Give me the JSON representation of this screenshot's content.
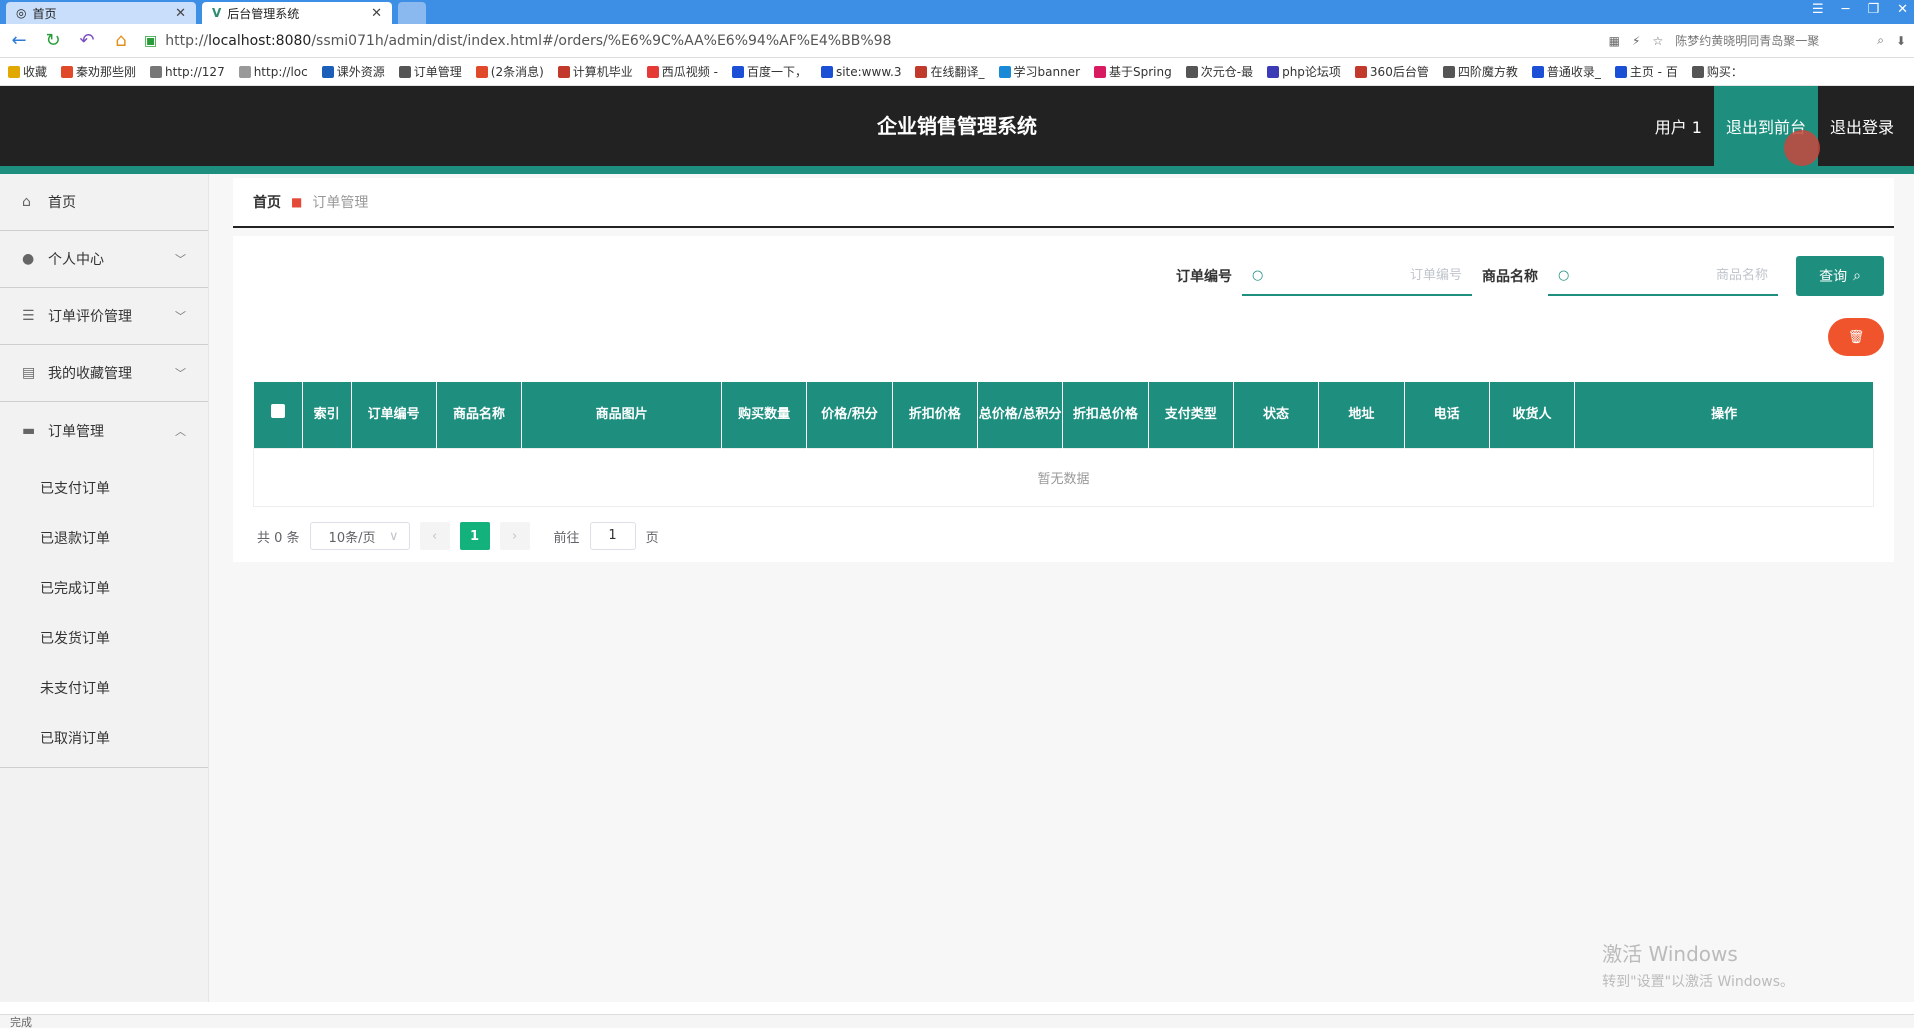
{
  "browser": {
    "tabs": [
      {
        "label": "首页",
        "active": false
      },
      {
        "label": "后台管理系统",
        "active": true
      }
    ],
    "url_prefix": "http://",
    "url_host": "localhost:8080",
    "url_path": "/ssmi071h/admin/dist/index.html#/orders/%E6%9C%AA%E6%94%AF%E4%BB%98",
    "search_hint": "陈梦约黄晓明同青岛聚一聚",
    "bookmarks": [
      "收藏",
      "秦劝那些刚",
      "http://127",
      "http://loc",
      "课外资源",
      "订单管理",
      "(2条消息)",
      "计算机毕业",
      "西瓜视频 -",
      "百度一下，",
      "site:www.3",
      "在线翻译_",
      "学习banner",
      "基于Spring",
      "次元仓-最",
      "php论坛项",
      "360后台管",
      "四阶魔方教",
      "普通收录_",
      "主页 - 百",
      "购买："
    ]
  },
  "header": {
    "title": "企业销售管理系统",
    "user": "用户 1",
    "back_to_front": "退出到前台",
    "logout": "退出登录"
  },
  "sidebar": {
    "items": [
      {
        "label": "首页",
        "icon": "home-icon"
      },
      {
        "label": "个人中心",
        "icon": "user-icon"
      },
      {
        "label": "订单评价管理",
        "icon": "list-icon"
      },
      {
        "label": "我的收藏管理",
        "icon": "briefcase-icon"
      },
      {
        "label": "订单管理",
        "icon": "ticket-icon"
      }
    ],
    "subitems": [
      "已支付订单",
      "已退款订单",
      "已完成订单",
      "已发货订单",
      "未支付订单",
      "已取消订单"
    ]
  },
  "breadcrumb": {
    "home": "首页",
    "current": "订单管理"
  },
  "search": {
    "order_no_label": "订单编号",
    "order_no_placeholder": "订单编号",
    "product_label": "商品名称",
    "product_placeholder": "商品名称",
    "query_button": "查询"
  },
  "table": {
    "headers": [
      "索引",
      "订单编号",
      "商品名称",
      "商品图片",
      "购买数量",
      "价格/积分",
      "折扣价格",
      "总价格/总积分",
      "折扣总价格",
      "支付类型",
      "状态",
      "地址",
      "电话",
      "收货人",
      "操作"
    ],
    "empty_text": "暂无数据"
  },
  "pagination": {
    "total": "共 0 条",
    "page_size": "10条/页",
    "current_page": "1",
    "goto_label": "前往",
    "goto_value": "1",
    "page_suffix": "页"
  },
  "watermark": {
    "line1": "激活 Windows",
    "line2": "转到\"设置\"以激活 Windows。"
  },
  "statusbar": {
    "text": "完成"
  },
  "colors": {
    "header_bg": "#222222",
    "accent": "#1e8f7f",
    "delete": "#f0542c",
    "page_active": "#13b27d"
  }
}
